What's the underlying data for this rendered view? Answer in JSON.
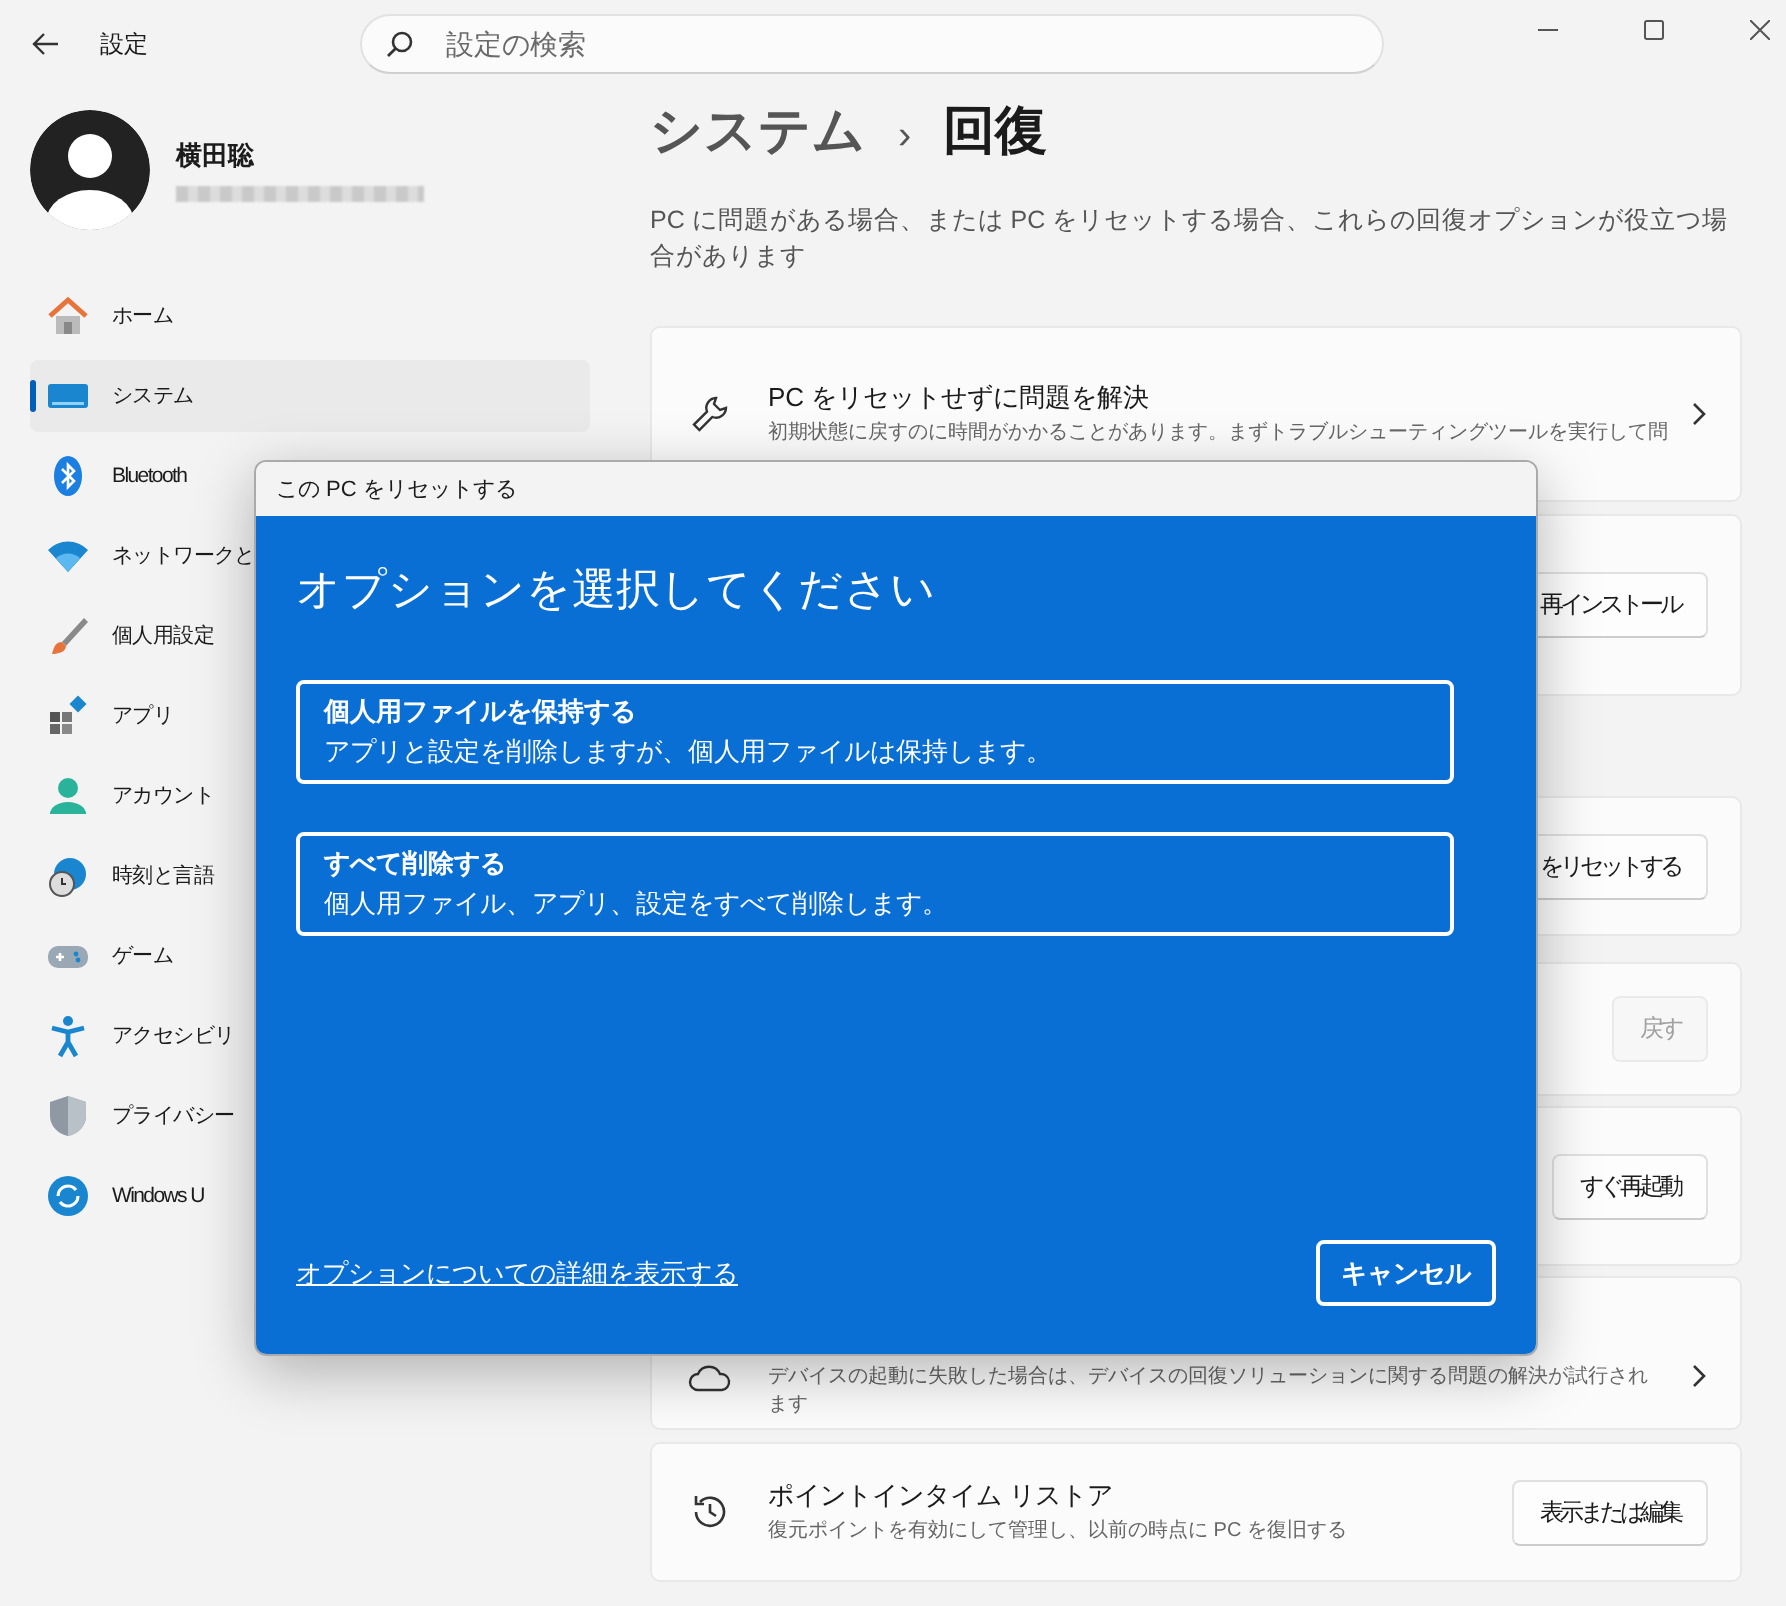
{
  "window": {
    "title": "設定",
    "search": {
      "placeholder": "設定の検索"
    }
  },
  "user": {
    "name": "横田聡"
  },
  "sidebar": {
    "items": [
      {
        "label": "ホーム",
        "selected": false
      },
      {
        "label": "システム",
        "selected": true
      },
      {
        "label": "Bluetooth",
        "selected": false
      },
      {
        "label": "ネットワークと",
        "selected": false
      },
      {
        "label": "個人用設定",
        "selected": false
      },
      {
        "label": "アプリ",
        "selected": false
      },
      {
        "label": "アカウント",
        "selected": false
      },
      {
        "label": "時刻と言語",
        "selected": false
      },
      {
        "label": "ゲーム",
        "selected": false
      },
      {
        "label": "アクセシビリ",
        "selected": false
      },
      {
        "label": "プライバシー",
        "selected": false
      },
      {
        "label": "Windows U",
        "selected": false
      }
    ]
  },
  "page": {
    "breadcrumb": "システム",
    "separator": "›",
    "title": "回復",
    "description": "PC に問題がある場合、または PC をリセットする場合、これらの回復オプションが役立つ場合があります"
  },
  "cards": [
    {
      "kind": "link",
      "title": "PC をリセットせずに問題を解決",
      "description": "初期状態に戻すのに時間がかかることがあります。まずトラブルシューティングツールを実行して問"
    },
    {
      "kind": "button",
      "button": {
        "label": "再インストール",
        "disabled": false
      }
    },
    {
      "kind": "button",
      "button": {
        "label": "をリセットする",
        "disabled": false
      }
    },
    {
      "kind": "button",
      "button": {
        "label": "戻す",
        "disabled": true
      }
    },
    {
      "kind": "button",
      "button": {
        "label": "すぐ再起動",
        "disabled": false
      }
    },
    {
      "kind": "link",
      "description": "デバイスの起動に失敗した場合は、デバイスの回復ソリューションに関する問題の解決が試行されます"
    },
    {
      "kind": "button",
      "title": "ポイントインタイム リストア",
      "description": "復元ポイントを有効にして管理し、以前の時点に PC を復旧する",
      "button": {
        "label": "表示または編集",
        "disabled": false
      }
    }
  ],
  "dialog": {
    "title": "この PC をリセットする",
    "heading": "オプションを選択してください",
    "options": [
      {
        "title": "個人用ファイルを保持する",
        "description": "アプリと設定を削除しますが、個人用ファイルは保持します。"
      },
      {
        "title": "すべて削除する",
        "description": "個人用ファイル、アプリ、設定をすべて削除します。"
      }
    ],
    "link": "オプションについての詳細を表示する",
    "cancel": "キャンセル"
  }
}
